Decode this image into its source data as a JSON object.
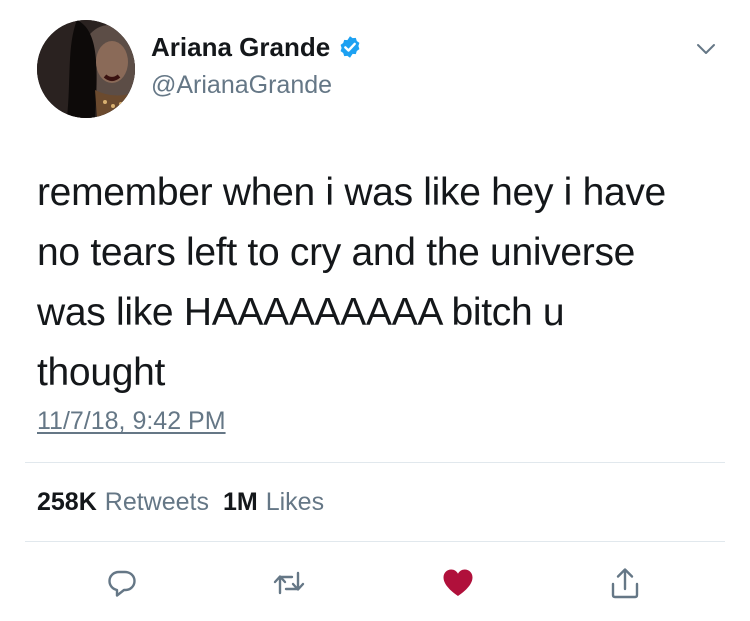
{
  "author": {
    "display_name": "Ariana Grande",
    "handle": "@ArianaGrande",
    "verified_icon": "verified-badge-icon",
    "avatar": "profile-photo"
  },
  "tweet": {
    "text": "remember when i was like hey i have\nno tears left to cry and the universe\nwas like HAAAAAAAAA bitch u\nthought",
    "timestamp": "11/7/18, 9:42 PM"
  },
  "stats": {
    "retweets_count": "258K",
    "retweets_label": "Retweets",
    "likes_count": "1M",
    "likes_label": "Likes"
  },
  "actions": {
    "reply_icon": "reply-icon",
    "retweet_icon": "retweet-icon",
    "like_icon": "like-heart-icon",
    "share_icon": "share-icon"
  },
  "colors": {
    "text_primary": "#14171a",
    "text_secondary": "#657786",
    "verified_blue": "#1da1f2",
    "like_red": "#b0103b",
    "divider": "#e1e8ed"
  }
}
